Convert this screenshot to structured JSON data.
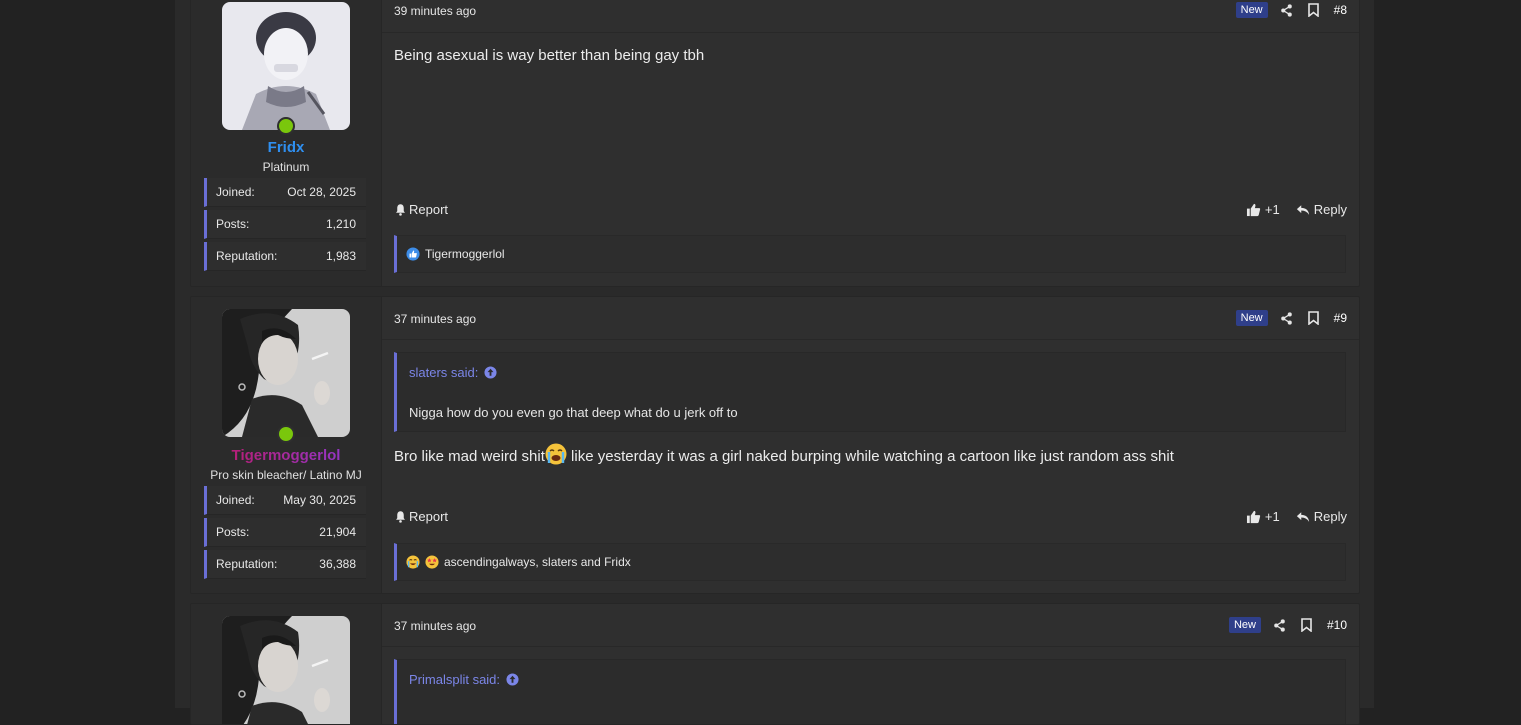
{
  "colors": {
    "accent": "#6a6fd6",
    "username_blue": "#2f8ff0",
    "username_gradient_start": "#c0175b",
    "username_gradient_end": "#8a3de0",
    "online": "#7ac70c",
    "badge_new": "#2f3f8a"
  },
  "posts": [
    {
      "username": "Fridx",
      "user_title": "Platinum",
      "stats": [
        {
          "label": "Joined:",
          "value": "Oct 28, 2025"
        },
        {
          "label": "Posts:",
          "value": "1,210"
        },
        {
          "label": "Reputation:",
          "value": "1,983"
        }
      ],
      "time": "39 minutes ago",
      "badge": "New",
      "number": "#8",
      "body": "Being asexual is way better than being gay tbh",
      "report_label": "Report",
      "like_count": "+1",
      "reply_label": "Reply",
      "reactions_text": "Tigermoggerlol",
      "reaction_icons": [
        "like-reaction-icon"
      ]
    },
    {
      "username": "Tigermoggerlol",
      "user_title": "Pro skin bleacher/ Latino MJ",
      "stats": [
        {
          "label": "Joined:",
          "value": "May 30, 2025"
        },
        {
          "label": "Posts:",
          "value": "21,904"
        },
        {
          "label": "Reputation:",
          "value": "36,388"
        }
      ],
      "time": "37 minutes ago",
      "badge": "New",
      "number": "#9",
      "quote_author": "slaters said:",
      "quote_text": "Nigga how do you even go that deep what do u jerk off to",
      "body_before": "Bro like mad weird shit",
      "body_after": " like yesterday it was a girl naked burping while watching a cartoon like just random ass shit",
      "report_label": "Report",
      "like_count": "+1",
      "reply_label": "Reply",
      "reactions_text": "ascendingalways, slaters and Fridx",
      "reaction_icons": [
        "crying-laugh-reaction-icon",
        "star-struck-reaction-icon"
      ]
    },
    {
      "time": "37 minutes ago",
      "badge": "New",
      "number": "#10",
      "quote_author": "Primalsplit said:"
    }
  ]
}
